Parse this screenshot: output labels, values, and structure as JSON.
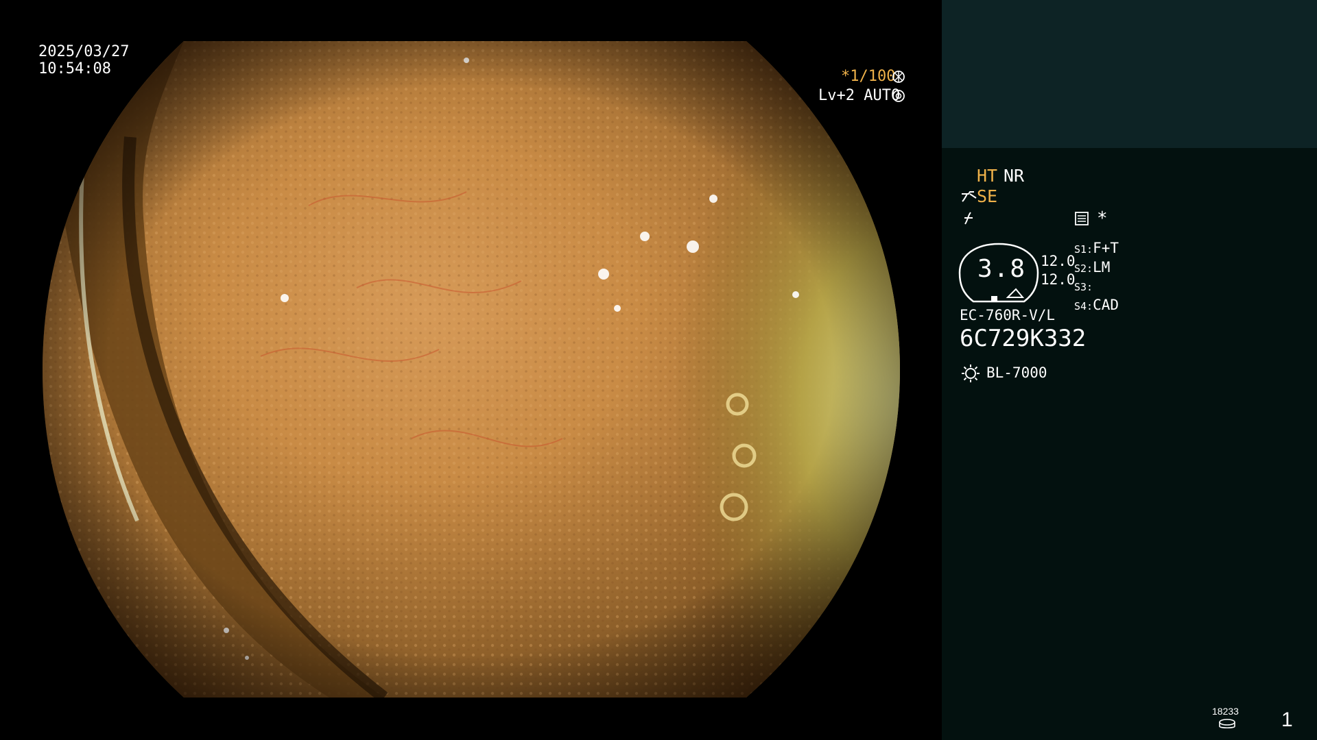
{
  "overlay": {
    "date": "2025/03/27",
    "time": "10:54:08",
    "shutter": "*1/100",
    "shutter_icon": "aperture-icon",
    "level": "Lv+2 AUTO",
    "level_icon": "iris-icon"
  },
  "panel": {
    "ht": "HT",
    "nr": "NR",
    "se": "SE",
    "se_icon": "scope-tip-icon",
    "freeze_icon": "freeze-icon",
    "menu_icon": "settings-list-icon",
    "star": "*",
    "gauge_value": "3.8",
    "zoom_top": "12.0",
    "zoom_bottom": "12.0",
    "switches": [
      {
        "key": "S1:",
        "value": "F+T"
      },
      {
        "key": "S2:",
        "value": "LM"
      },
      {
        "key": "S3:",
        "value": ""
      },
      {
        "key": "S4:",
        "value": "CAD"
      }
    ],
    "scope_model": "EC-760R-V/L",
    "serial": "6C729K332",
    "light_icon": "sun-icon",
    "light_source": "BL-7000",
    "storage_count": "18233",
    "storage_icon": "disk-icon",
    "page_number": "1"
  },
  "colors": {
    "accent_orange": "#f0b24a",
    "panel_top": "#0d2325",
    "panel_bottom": "#03110f"
  }
}
